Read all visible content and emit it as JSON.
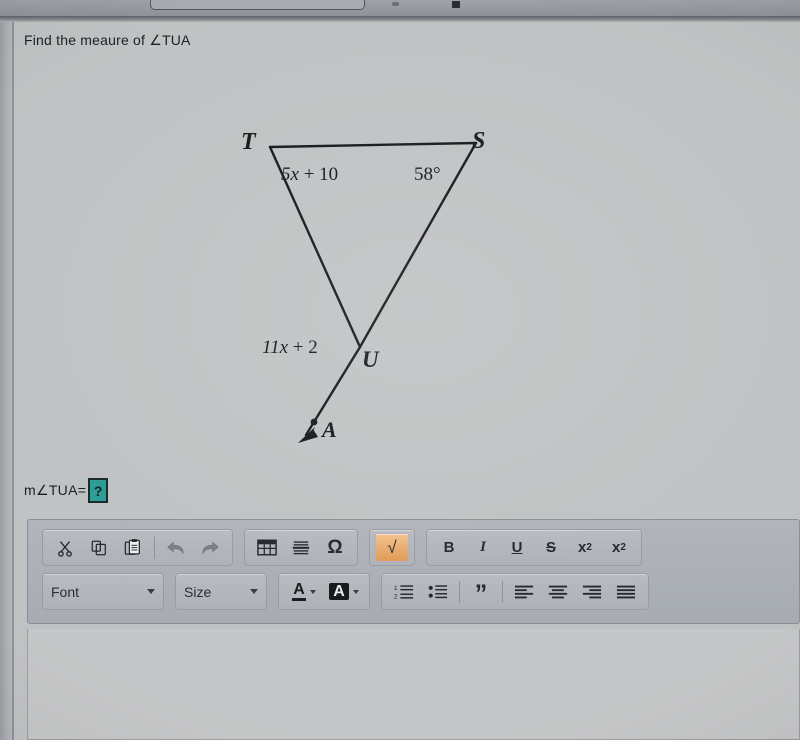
{
  "question": {
    "prompt": "Find the meaure of ∠TUA"
  },
  "figure": {
    "type": "triangle-with-exterior-ray",
    "vertices": {
      "T": "T",
      "S": "S",
      "U": "U",
      "A": "A"
    },
    "angle_labels": {
      "at_T": "5x + 10",
      "at_S": "58°",
      "at_U_exterior": "11x + 2"
    },
    "expr_T_coefficient": "5x",
    "expr_T_constant": "+ 10",
    "expr_U_coefficient": "11x",
    "expr_U_constant": "+ 2",
    "expr_S_value": "58°"
  },
  "answer": {
    "label": "m∠TUA=",
    "input_value": "?",
    "box_color": "#2f9d96"
  },
  "toolbar": {
    "row1": {
      "clipboard_group": [
        {
          "name": "cut-icon",
          "label": "Cut"
        },
        {
          "name": "copy-icon",
          "label": "Copy"
        },
        {
          "name": "paste-icon",
          "label": "Paste"
        }
      ],
      "history_group": [
        {
          "name": "undo-icon",
          "label": "Undo"
        },
        {
          "name": "redo-icon",
          "label": "Redo"
        }
      ],
      "insert_group": [
        {
          "name": "table-icon",
          "label": "Insert table"
        },
        {
          "name": "horizontal-rule-icon",
          "label": "Insert horizontal line"
        },
        {
          "name": "special-character-icon",
          "label": "Ω"
        }
      ],
      "equation_group": [
        {
          "name": "square-root-icon",
          "label": "√",
          "active": true
        }
      ],
      "format_group": [
        {
          "name": "bold-button",
          "label": "B"
        },
        {
          "name": "italic-button",
          "label": "I"
        },
        {
          "name": "underline-button",
          "label": "U"
        },
        {
          "name": "strikethrough-button",
          "label": "S"
        },
        {
          "name": "subscript-button",
          "label": "x",
          "script": "2"
        },
        {
          "name": "superscript-button",
          "label": "x",
          "script": "2"
        }
      ]
    },
    "row2": {
      "font_select": {
        "label": "Font"
      },
      "size_select": {
        "label": "Size"
      },
      "text_color_button": {
        "label": "A"
      },
      "highlight_color_button": {
        "label": "A"
      },
      "list_group": [
        {
          "name": "numbered-list-icon",
          "label": "Numbered list"
        },
        {
          "name": "bulleted-list-icon",
          "label": "Bulleted list"
        }
      ],
      "quote_group": [
        {
          "name": "blockquote-icon",
          "label": "”"
        }
      ],
      "align_group": [
        {
          "name": "align-left-icon",
          "label": "Align left"
        },
        {
          "name": "align-center-icon",
          "label": "Align center"
        },
        {
          "name": "align-right-icon",
          "label": "Align right"
        },
        {
          "name": "align-justify-icon",
          "label": "Justify"
        }
      ]
    }
  },
  "editor_body": {
    "content": ""
  }
}
